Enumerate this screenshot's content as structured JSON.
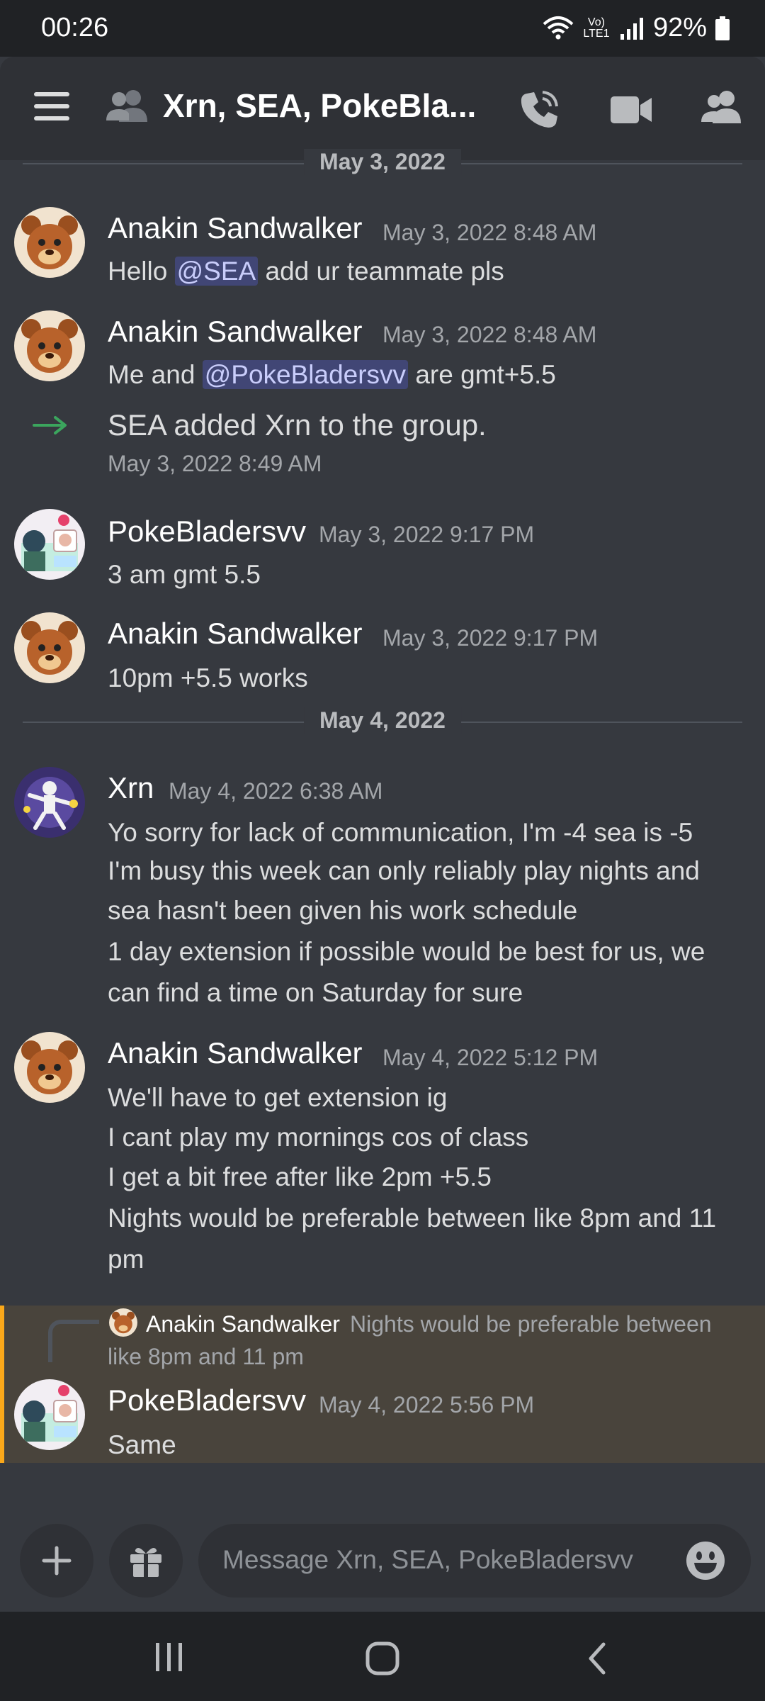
{
  "status_bar": {
    "time": "00:26",
    "network_label": "Vo) LTE1",
    "battery": "92%"
  },
  "header": {
    "title": "Xrn, SEA, PokeBla..."
  },
  "dividers": {
    "may3": "May 3, 2022",
    "may4": "May 4, 2022"
  },
  "messages": [
    {
      "author": "Anakin Sandwalker",
      "time": "May 3, 2022 8:48 AM",
      "pre": "Hello ",
      "mention": "@SEA",
      "post": " add ur teammate pls"
    },
    {
      "author": "Anakin Sandwalker",
      "time": "May 3, 2022 8:48 AM",
      "pre": "Me and ",
      "mention": "@PokeBladersvv",
      "post": " are gmt+5.5"
    },
    {
      "system_text": "SEA added Xrn to the group.",
      "time": "May 3, 2022 8:49 AM"
    },
    {
      "author": "PokeBladersvv",
      "time": "May 3, 2022 9:17 PM",
      "lines": [
        "3 am gmt 5.5"
      ]
    },
    {
      "author": "Anakin Sandwalker",
      "time": "May 3, 2022 9:17 PM",
      "lines": [
        "10pm +5.5 works"
      ]
    },
    {
      "author": "Xrn",
      "time": "May 4, 2022 6:38 AM",
      "lines": [
        "Yo sorry for lack of communication, I'm -4 sea is -5",
        "I'm busy this week can only reliably play nights and",
        "sea hasn't been given his work schedule",
        "1 day extension if possible would be best for us, we",
        "can find a time on Saturday for sure"
      ]
    },
    {
      "author": "Anakin Sandwalker",
      "time": "May 4, 2022 5:12 PM",
      "lines": [
        "We'll have to get extension ig",
        "I cant play my mornings cos of class",
        "I get a bit free after like 2pm +5.5",
        "Nights would be preferable between like 8pm and 11",
        "pm"
      ]
    },
    {
      "reply_to_author": "Anakin Sandwalker",
      "reply_line1": "Nights would be preferable between",
      "reply_line2": "like 8pm and 11 pm",
      "author": "PokeBladersvv",
      "time": "May 4, 2022 5:56 PM",
      "lines": [
        "Same"
      ]
    }
  ],
  "composer": {
    "placeholder": "Message Xrn, SEA, PokeBladersvv"
  },
  "colors": {
    "background": "#36393f",
    "header": "#2f3136",
    "mention_bg": "#414675",
    "reply_highlight": "#49443c",
    "reply_bar": "#faa81a",
    "system_arrow": "#3ba55d"
  },
  "icons": {
    "menu": "hamburger-menu-icon",
    "group": "group-dm-icon",
    "call": "phone-call-icon",
    "video": "video-camera-icon",
    "members": "members-icon",
    "add": "plus-icon",
    "gift": "gift-icon",
    "emoji": "emoji-icon"
  }
}
